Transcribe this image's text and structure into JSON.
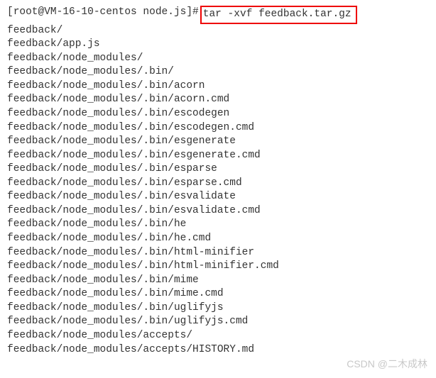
{
  "prompt": "[root@VM-16-10-centos node.js]#",
  "command": "tar -xvf feedback.tar.gz",
  "highlight_color": "#ee0000",
  "output_lines": [
    "feedback/",
    "feedback/app.js",
    "feedback/node_modules/",
    "feedback/node_modules/.bin/",
    "feedback/node_modules/.bin/acorn",
    "feedback/node_modules/.bin/acorn.cmd",
    "feedback/node_modules/.bin/escodegen",
    "feedback/node_modules/.bin/escodegen.cmd",
    "feedback/node_modules/.bin/esgenerate",
    "feedback/node_modules/.bin/esgenerate.cmd",
    "feedback/node_modules/.bin/esparse",
    "feedback/node_modules/.bin/esparse.cmd",
    "feedback/node_modules/.bin/esvalidate",
    "feedback/node_modules/.bin/esvalidate.cmd",
    "feedback/node_modules/.bin/he",
    "feedback/node_modules/.bin/he.cmd",
    "feedback/node_modules/.bin/html-minifier",
    "feedback/node_modules/.bin/html-minifier.cmd",
    "feedback/node_modules/.bin/mime",
    "feedback/node_modules/.bin/mime.cmd",
    "feedback/node_modules/.bin/uglifyjs",
    "feedback/node_modules/.bin/uglifyjs.cmd",
    "feedback/node_modules/accepts/",
    "feedback/node_modules/accepts/HISTORY.md"
  ],
  "watermark": "CSDN @二木成林"
}
